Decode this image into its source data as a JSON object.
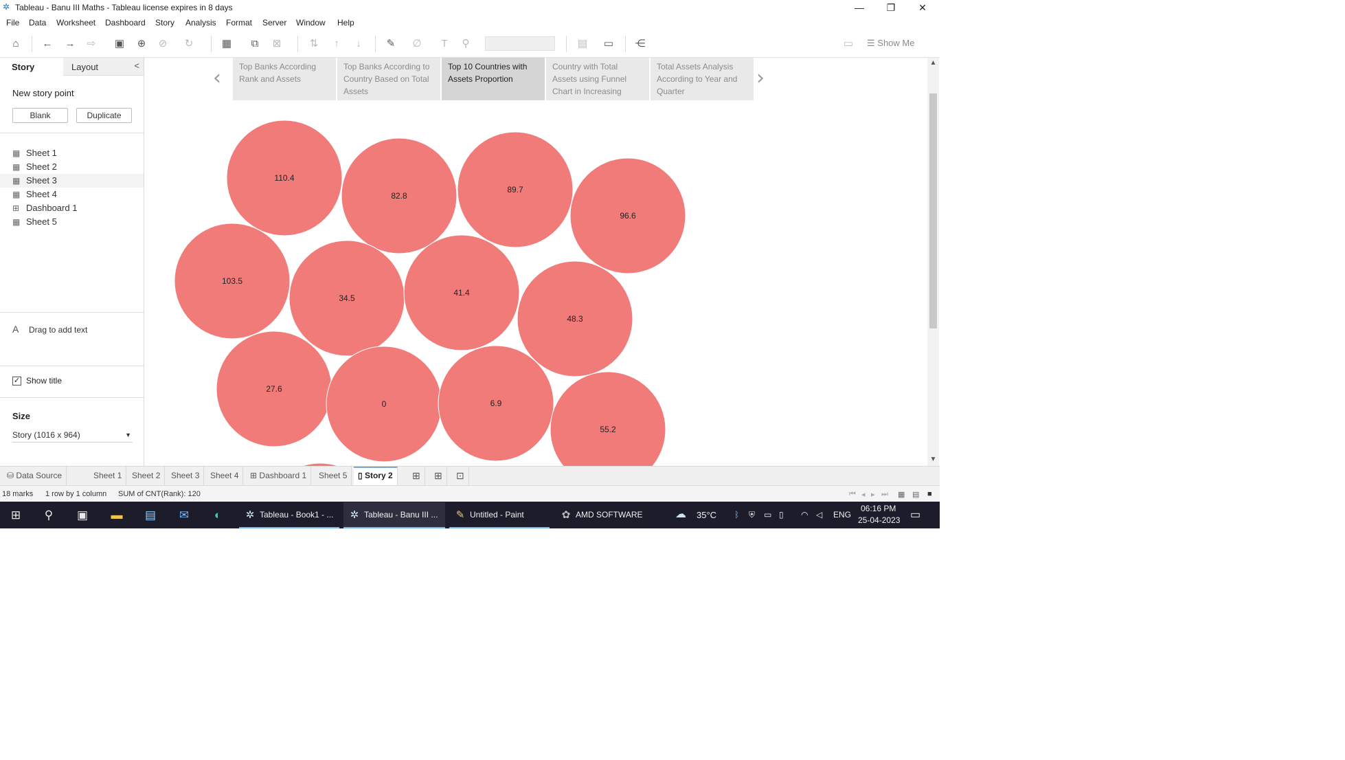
{
  "window": {
    "title": "Tableau - Banu III Maths - Tableau license expires in 8 days",
    "minimize": "—",
    "restore": "❐",
    "close": "✕"
  },
  "menu": [
    "File",
    "Data",
    "Worksheet",
    "Dashboard",
    "Story",
    "Analysis",
    "Format",
    "Server",
    "Window",
    "Help"
  ],
  "toolbar": {
    "show_me": "Show Me"
  },
  "left_pane": {
    "tab_story": "Story",
    "tab_layout": "Layout",
    "collapse": "<",
    "new_story_point": "New story point",
    "blank_button": "Blank",
    "duplicate_button": "Duplicate",
    "sheets": [
      "Sheet 1",
      "Sheet 2",
      "Sheet 3",
      "Sheet 4",
      "Dashboard 1",
      "Sheet 5"
    ],
    "drag_text": "Drag to add text",
    "show_title": "Show title",
    "size_heading": "Size",
    "size_value": "Story (1016 x 964)"
  },
  "story_points": [
    "Top Banks According Rank and Assets",
    "Top Banks According to Country Based on Total Assets",
    "Top 10 Countries with Assets Proportion",
    "Country with Total Assets using Funnel Chart in Increasing",
    "Total Assets Analysis According to Year and Quarter"
  ],
  "active_story_point": 2,
  "chart_data": {
    "type": "bubble",
    "fill_color": "#f07b79",
    "values": [
      110.4,
      82.8,
      89.7,
      96.6,
      103.5,
      34.5,
      41.4,
      48.3,
      27.6,
      0,
      6.9,
      55.2
    ]
  },
  "sheet_tabs": {
    "data_source": "Data Source",
    "tabs": [
      "Sheet 1",
      "Sheet 2",
      "Sheet 3",
      "Sheet 4",
      "Dashboard 1",
      "Sheet 5",
      "Story 2"
    ],
    "active": "Story 2"
  },
  "status": {
    "marks": "18 marks",
    "rows_cols": "1 row by 1 column",
    "sum": "SUM of CNT(Rank): 120"
  },
  "taskbar": {
    "apps": [
      "Tableau - Book1 - ...",
      "Tableau - Banu III ...",
      "Untitled - Paint",
      "AMD SOFTWARE"
    ],
    "weather": "35°C",
    "lang": "ENG",
    "time": "06:16 PM",
    "date": "25-04-2023"
  }
}
